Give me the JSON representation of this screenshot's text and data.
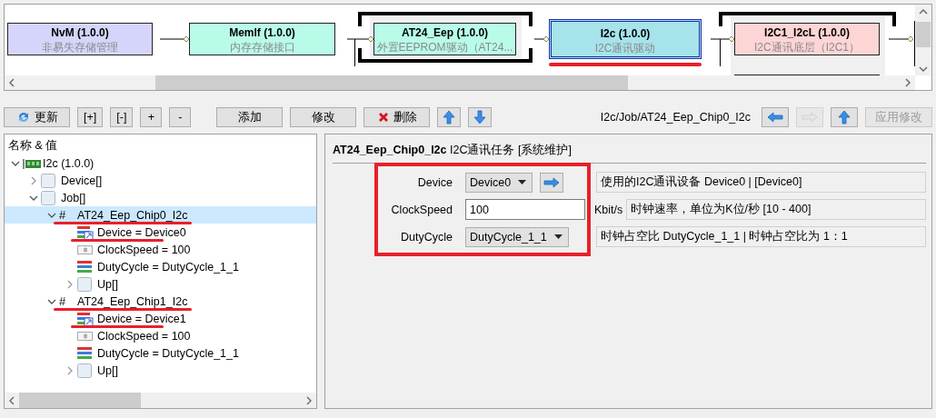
{
  "diagram": {
    "nodes": [
      {
        "title": "NvM (1.0.0)",
        "subtitle": "非易失存储管理",
        "color": "#d5d5fc",
        "selected": false,
        "bracketed": false
      },
      {
        "title": "MemIf (1.0.0)",
        "subtitle": "内存存储接口",
        "color": "#b9fbe9",
        "selected": false,
        "bracketed": false
      },
      {
        "title": "AT24_Eep (1.0.0)",
        "subtitle": "外置EEPROM驱动（AT24...",
        "color": "#b9fbe9",
        "selected": false,
        "bracketed": true
      },
      {
        "title": "I2c (1.0.0)",
        "subtitle": "I2C通讯驱动",
        "color": "#a6e3eb",
        "selected": true,
        "bracketed": false,
        "highlighted": true
      },
      {
        "title": "I2C1_I2cL (1.0.0)",
        "subtitle": "I2C通讯底层（I2C1）",
        "color": "#fdd5d5",
        "selected": false,
        "bracketed": true
      }
    ]
  },
  "toolbar": {
    "buttons": [
      {
        "kind": "refresh",
        "label": "更新"
      },
      {
        "kind": "text",
        "label": "[+]"
      },
      {
        "kind": "text",
        "label": "[-]"
      },
      {
        "kind": "text",
        "label": "+"
      },
      {
        "kind": "text",
        "label": "-"
      },
      {
        "kind": "wide",
        "label": "添加"
      },
      {
        "kind": "wide",
        "label": "修改"
      },
      {
        "kind": "delete",
        "label": "删除"
      },
      {
        "kind": "up"
      },
      {
        "kind": "down"
      }
    ],
    "path": "I2c/Job/AT24_Eep_Chip0_I2c",
    "nav": [
      {
        "kind": "back",
        "disabled": false
      },
      {
        "kind": "forward",
        "disabled": true
      },
      {
        "kind": "up",
        "disabled": false
      }
    ],
    "apply": {
      "label": "应用修改",
      "disabled": true
    }
  },
  "tree": {
    "header": "名称 & 值",
    "items": [
      {
        "label": "I2c (1.0.0)",
        "kind": "module",
        "expanded": true,
        "selected": false,
        "highlighted": false,
        "children": [
          {
            "label": "Device[]",
            "kind": "container",
            "expanded": false,
            "selected": false,
            "highlighted": false
          },
          {
            "label": "Job[]",
            "kind": "container",
            "expanded": true,
            "selected": false,
            "highlighted": false,
            "children": [
              {
                "label": "AT24_Eep_Chip0_I2c",
                "kind": "instance",
                "marker": "#",
                "expanded": true,
                "selected": true,
                "highlighted": true,
                "children": [
                  {
                    "label": "Device = Device0",
                    "kind": "reference",
                    "selected": false,
                    "highlighted": true
                  },
                  {
                    "label": "ClockSpeed = 100",
                    "kind": "number",
                    "selected": false,
                    "highlighted": false
                  },
                  {
                    "label": "DutyCycle = DutyCycle_1_1",
                    "kind": "enum",
                    "selected": false,
                    "highlighted": false
                  },
                  {
                    "label": "Up[]",
                    "kind": "container",
                    "expanded": false,
                    "selected": false,
                    "highlighted": false
                  }
                ]
              },
              {
                "label": "AT24_Eep_Chip1_I2c",
                "kind": "instance",
                "marker": "#",
                "expanded": true,
                "selected": false,
                "highlighted": true,
                "children": [
                  {
                    "label": "Device = Device1",
                    "kind": "reference",
                    "selected": false,
                    "highlighted": true
                  },
                  {
                    "label": "ClockSpeed = 100",
                    "kind": "number",
                    "selected": false,
                    "highlighted": false
                  },
                  {
                    "label": "DutyCycle = DutyCycle_1_1",
                    "kind": "enum",
                    "selected": false,
                    "highlighted": false
                  },
                  {
                    "label": "Up[]",
                    "kind": "container",
                    "expanded": false,
                    "selected": false,
                    "highlighted": false
                  }
                ]
              }
            ]
          }
        ]
      }
    ]
  },
  "properties": {
    "title": "AT24_Eep_Chip0_I2c",
    "note": "I2C通讯任务 [系统维护]",
    "highlighted": true,
    "fields": [
      {
        "kind": "dropdown",
        "label": "Device",
        "value": "Device0",
        "link": true,
        "description": "使用的I2C通讯设备 Device0 | [Device0]"
      },
      {
        "kind": "text",
        "label": "ClockSpeed",
        "value": "100",
        "unit": "Kbit/s",
        "description": "时钟速率，单位为K位/秒 [10 - 400]"
      },
      {
        "kind": "dropdown",
        "label": "DutyCycle",
        "value": "DutyCycle_1_1",
        "link": false,
        "description": "时钟占空比 DutyCycle_1_1 | 时钟占空比为 1：1"
      }
    ]
  }
}
